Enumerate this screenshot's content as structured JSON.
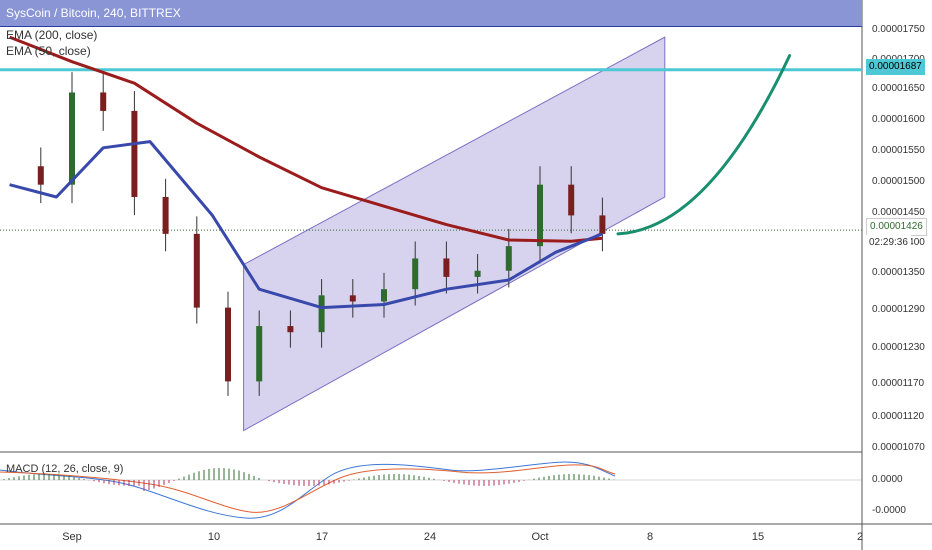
{
  "header": {
    "symbol_title": "SysCoin / Bitcoin, 240, BITTREX",
    "indicators": [
      "EMA (200, close)",
      "EMA (50, close)"
    ],
    "macd_label": "MACD (12, 26, close, 9)"
  },
  "price_axis": {
    "ticks": [
      "0.00001750",
      "0.00001700",
      "0.00001650",
      "0.00001600",
      "0.00001550",
      "0.00001500",
      "0.00001450",
      "0.00001400",
      "0.00001350",
      "0.00001290",
      "0.00001230",
      "0.00001170",
      "0.00001120",
      "0.00001070"
    ],
    "resistance_tag": "0.00001687",
    "last_price_tag": "0.00001426",
    "countdown_tag": "02:29:36"
  },
  "macd_axis": {
    "ticks": [
      "0.0000",
      "-0.0000"
    ]
  },
  "time_axis": {
    "ticks": [
      "Sep",
      "10",
      "17",
      "24",
      "Oct",
      "8",
      "15",
      "2"
    ]
  },
  "colors": {
    "ema200": "#9b1c1c",
    "ema50": "#3949ab",
    "channel_fill": "#b7aee0",
    "resistance": "#4dc8d4",
    "projection": "#1a8f6f",
    "candle_up": "#2f6b2f",
    "candle_down": "#7a1f1f",
    "title_bar": "#8a95d6"
  },
  "chart_data": {
    "type": "candlestick",
    "symbol": "SysCoin / Bitcoin",
    "interval": "240",
    "exchange": "BITTREX",
    "ylim": [
      1.05e-05,
      1.8e-05
    ],
    "x_ticks": [
      "Sep",
      "10",
      "17",
      "24",
      "Oct",
      "8",
      "15",
      "2"
    ],
    "series": [
      {
        "name": "EMA (200, close)",
        "x": [
          "Aug 28",
          "Sep 1",
          "Sep 5",
          "Sep 9",
          "Sep 13",
          "Sep 17",
          "Sep 21",
          "Sep 25",
          "Sep 29",
          "Oct 3",
          "Oct 5"
        ],
        "values": [
          1.74e-05,
          1.7e-05,
          1.665e-05,
          1.6e-05,
          1.545e-05,
          1.495e-05,
          1.465e-05,
          1.435e-05,
          1.41e-05,
          1.408e-05,
          1.413e-05
        ]
      },
      {
        "name": "EMA (50, close)",
        "x": [
          "Aug 28",
          "Aug 31",
          "Sep 3",
          "Sep 6",
          "Sep 10",
          "Sep 13",
          "Sep 17",
          "Sep 21",
          "Sep 25",
          "Sep 29",
          "Oct 2",
          "Oct 5"
        ],
        "values": [
          1.5e-05,
          1.48e-05,
          1.56e-05,
          1.57e-05,
          1.45e-05,
          1.33e-05,
          1.3e-05,
          1.305e-05,
          1.33e-05,
          1.345e-05,
          1.39e-05,
          1.42e-05
        ]
      }
    ],
    "candles_approx": [
      {
        "x": "Aug 28",
        "close": 1.53e-05
      },
      {
        "x": "Aug 30",
        "close": 1.5e-05
      },
      {
        "x": "Sep 1",
        "close": 1.65e-05
      },
      {
        "x": "Sep 3",
        "close": 1.62e-05
      },
      {
        "x": "Sep 5",
        "close": 1.48e-05
      },
      {
        "x": "Sep 7",
        "close": 1.42e-05
      },
      {
        "x": "Sep 9",
        "close": 1.3e-05
      },
      {
        "x": "Sep 11",
        "close": 1.18e-05
      },
      {
        "x": "Sep 13",
        "close": 1.27e-05
      },
      {
        "x": "Sep 15",
        "close": 1.26e-05
      },
      {
        "x": "Sep 17",
        "close": 1.32e-05
      },
      {
        "x": "Sep 19",
        "close": 1.31e-05
      },
      {
        "x": "Sep 21",
        "close": 1.33e-05
      },
      {
        "x": "Sep 23",
        "close": 1.38e-05
      },
      {
        "x": "Sep 25",
        "close": 1.35e-05
      },
      {
        "x": "Sep 27",
        "close": 1.36e-05
      },
      {
        "x": "Sep 29",
        "close": 1.4e-05
      },
      {
        "x": "Oct 1",
        "close": 1.5e-05
      },
      {
        "x": "Oct 3",
        "close": 1.45e-05
      },
      {
        "x": "Oct 5",
        "close": 1.42e-05
      }
    ],
    "resistance_level": 1.687e-05,
    "last_price": 1.426e-05,
    "ascending_channel": {
      "lower": [
        [
          "Sep 12",
          1.1e-05
        ],
        [
          "Oct 9",
          1.48e-05
        ]
      ],
      "upper": [
        [
          "Sep 12",
          1.37e-05
        ],
        [
          "Oct 9",
          1.74e-05
        ]
      ]
    },
    "projection_curve": {
      "from": [
        "Oct 6",
        1.42e-05
      ],
      "to": [
        "Oct 17",
        1.71e-05
      ]
    },
    "macd": {
      "name": "MACD (12, 26, close, 9)",
      "ylim": [
        -4e-07,
        3e-07
      ]
    }
  }
}
